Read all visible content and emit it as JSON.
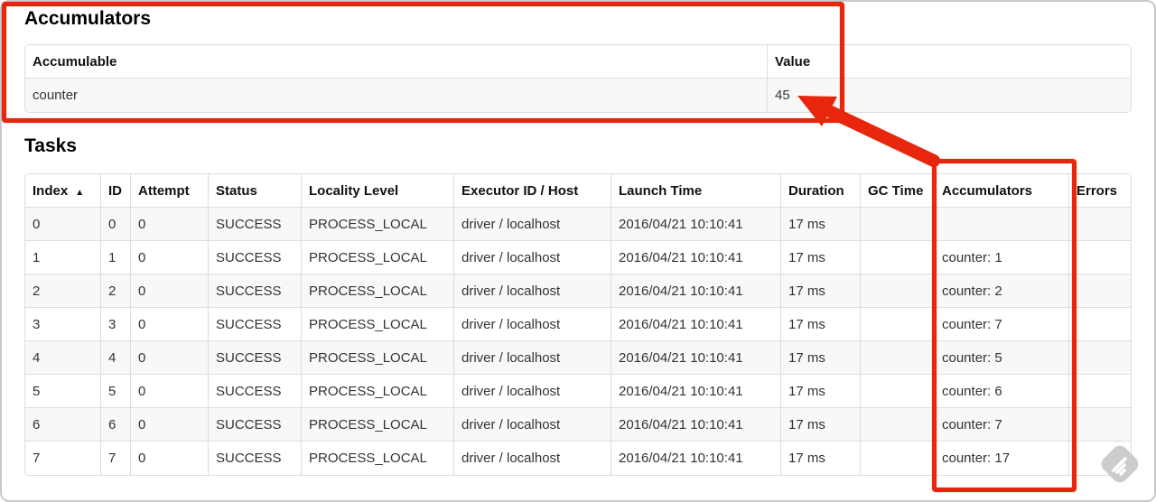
{
  "annotation": {
    "color": "#e8260d"
  },
  "accumulators_section": {
    "title": "Accumulators",
    "table": {
      "headers": [
        "Accumulable",
        "Value"
      ],
      "cell_names": [
        "cell-accumulable",
        "cell-value"
      ],
      "rows": [
        [
          "counter",
          "45"
        ]
      ]
    }
  },
  "tasks_section": {
    "title": "Tasks",
    "table": {
      "headers": [
        "Index",
        "ID",
        "Attempt",
        "Status",
        "Locality Level",
        "Executor ID / Host",
        "Launch Time",
        "Duration",
        "GC Time",
        "Accumulators",
        "Errors"
      ],
      "sort": {
        "column": "Index",
        "direction_icon": "▲"
      },
      "cell_names": [
        "cell-index",
        "cell-id",
        "cell-attempt",
        "cell-status",
        "cell-locality-level",
        "cell-executor-id-host",
        "cell-launch-time",
        "cell-duration",
        "cell-gc-time",
        "cell-accumulators",
        "cell-errors"
      ],
      "rows": [
        [
          "0",
          "0",
          "0",
          "SUCCESS",
          "PROCESS_LOCAL",
          "driver / localhost",
          "2016/04/21 10:10:41",
          "17 ms",
          "",
          "",
          ""
        ],
        [
          "1",
          "1",
          "0",
          "SUCCESS",
          "PROCESS_LOCAL",
          "driver / localhost",
          "2016/04/21 10:10:41",
          "17 ms",
          "",
          "counter: 1",
          ""
        ],
        [
          "2",
          "2",
          "0",
          "SUCCESS",
          "PROCESS_LOCAL",
          "driver / localhost",
          "2016/04/21 10:10:41",
          "17 ms",
          "",
          "counter: 2",
          ""
        ],
        [
          "3",
          "3",
          "0",
          "SUCCESS",
          "PROCESS_LOCAL",
          "driver / localhost",
          "2016/04/21 10:10:41",
          "17 ms",
          "",
          "counter: 7",
          ""
        ],
        [
          "4",
          "4",
          "0",
          "SUCCESS",
          "PROCESS_LOCAL",
          "driver / localhost",
          "2016/04/21 10:10:41",
          "17 ms",
          "",
          "counter: 5",
          ""
        ],
        [
          "5",
          "5",
          "0",
          "SUCCESS",
          "PROCESS_LOCAL",
          "driver / localhost",
          "2016/04/21 10:10:41",
          "17 ms",
          "",
          "counter: 6",
          ""
        ],
        [
          "6",
          "6",
          "0",
          "SUCCESS",
          "PROCESS_LOCAL",
          "driver / localhost",
          "2016/04/21 10:10:41",
          "17 ms",
          "",
          "counter: 7",
          ""
        ],
        [
          "7",
          "7",
          "0",
          "SUCCESS",
          "PROCESS_LOCAL",
          "driver / localhost",
          "2016/04/21 10:10:41",
          "17 ms",
          "",
          "counter: 17",
          ""
        ]
      ]
    }
  }
}
